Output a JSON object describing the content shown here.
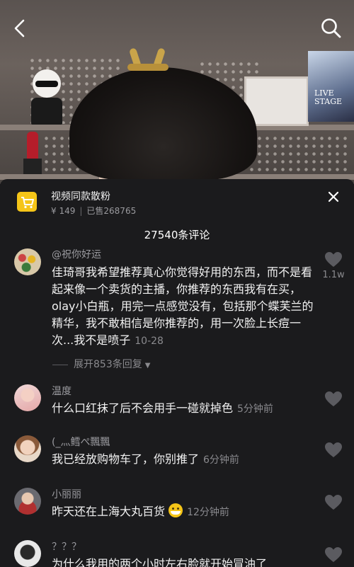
{
  "product": {
    "title": "视频同款散粉",
    "price": "¥ 149",
    "sold": "已售268765"
  },
  "comments_header": "27540条评论",
  "comments": [
    {
      "user": "@祝你好运",
      "text": "佳琦哥我希望推荐真心你觉得好用的东西，而不是看起来像一个卖货的主播，你推荐的东西我有在买，olay小白瓶，用完一点感觉没有，包括那个蝶芙兰的精华，我不敢相信是你推荐的，用一次脸上长痘一次...我不是喷子",
      "time": "10-28",
      "likes": "1.1w",
      "replies": "展开853条回复"
    },
    {
      "user": "温度",
      "text": "什么口红抹了后不会用手一碰就掉色",
      "time": "5分钟前"
    },
    {
      "user": "(_灬鳕ぺ飄飄",
      "text": "我已经放购物车了，你别推了",
      "time": "6分钟前"
    },
    {
      "user": "小丽丽",
      "text": "昨天还在上海大丸百货",
      "time": "12分钟前"
    },
    {
      "user": "？？？",
      "text": "为什么我用的两个小时左右脸就开始冒油了"
    }
  ],
  "poster_text": [
    "LIVE",
    "STAGE"
  ],
  "icons": {
    "back": "chevron-left-icon",
    "search": "search-icon",
    "cart": "shopping-cart-icon",
    "close": "close-icon",
    "like": "heart-icon"
  },
  "colors": {
    "accent": "#f5c518",
    "sheet_bg": "#1b1b1d",
    "muted": "#8a8a8e"
  }
}
